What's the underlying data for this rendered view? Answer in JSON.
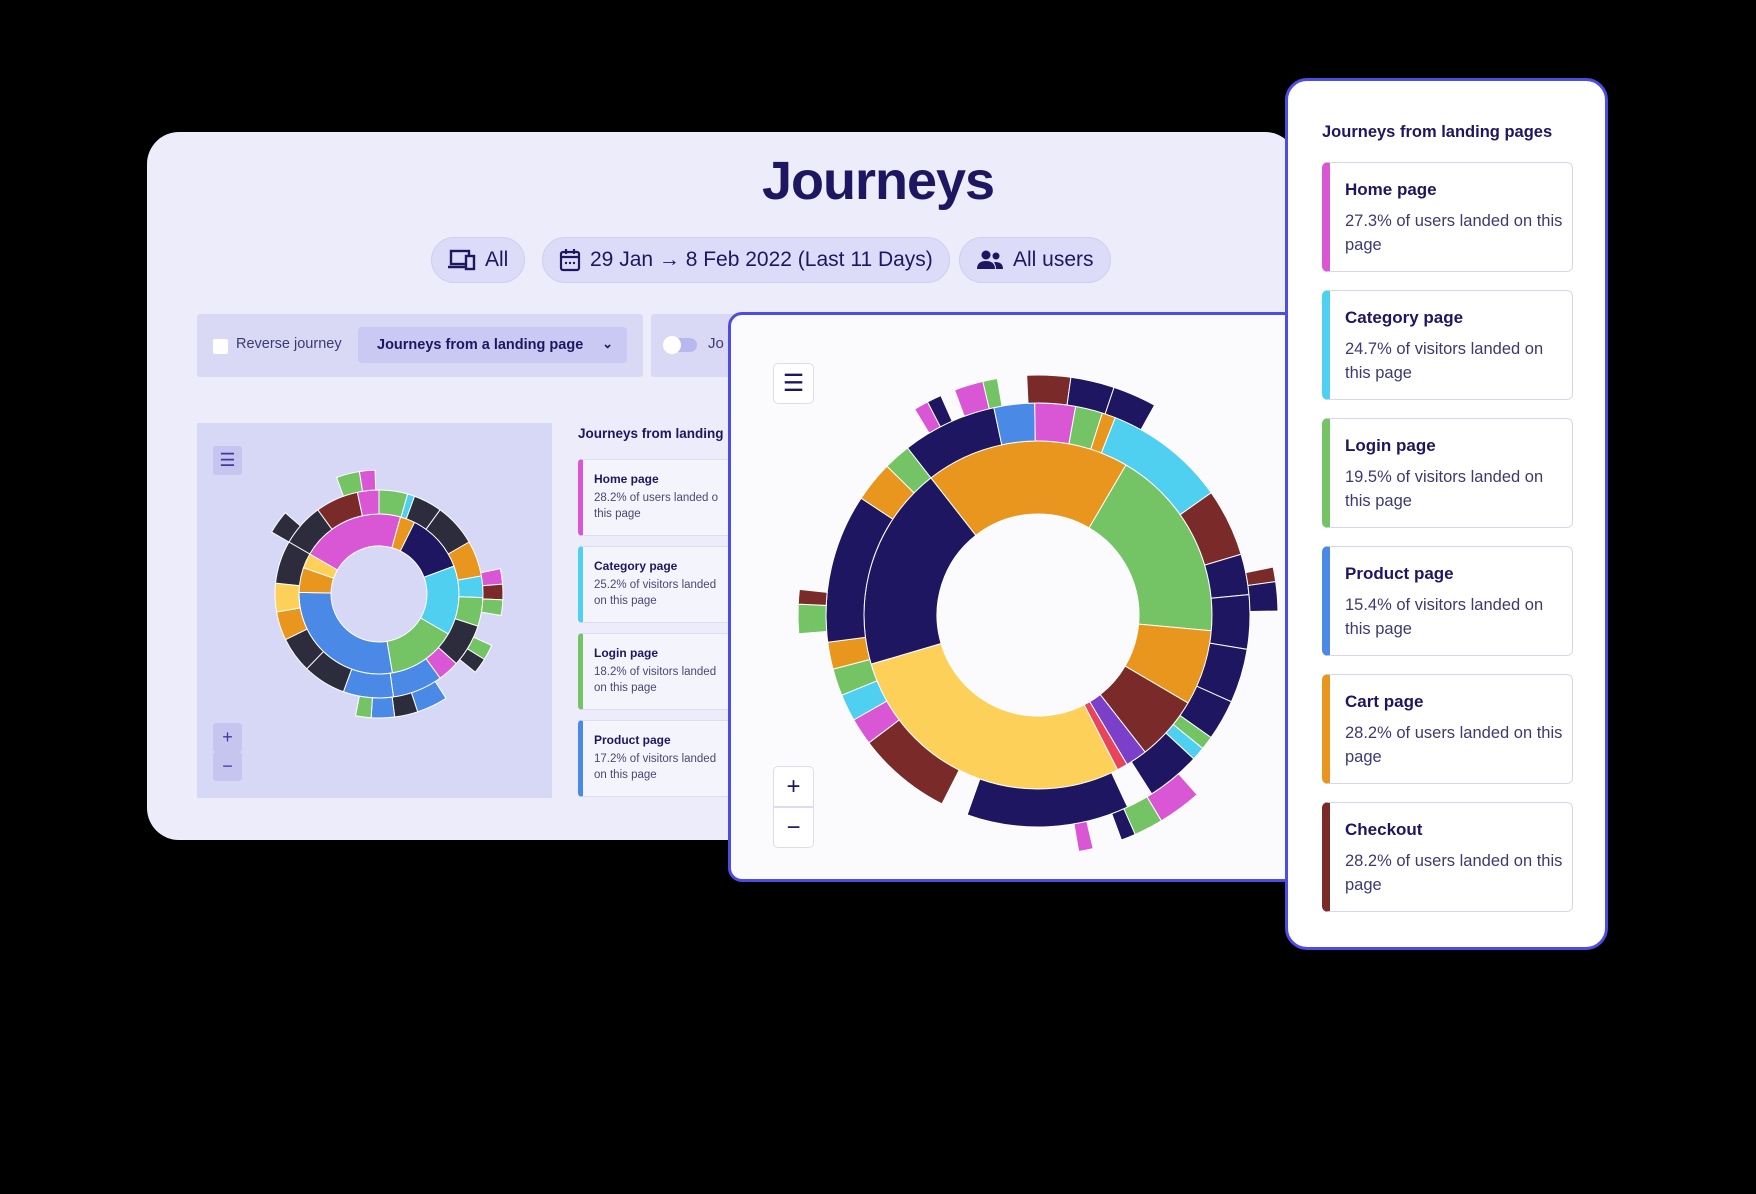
{
  "page": {
    "title": "Journeys"
  },
  "filters": {
    "device": {
      "label": "All",
      "icon": "devices-icon"
    },
    "date": {
      "label": "29 Jan → 8 Feb 2022 (Last 11 Days)",
      "icon": "calendar-icon"
    },
    "segment": {
      "label": "All users",
      "icon": "users-icon"
    }
  },
  "controls": {
    "reverse_label": "Reverse journey",
    "reverse_checked": false,
    "journey_type": "Journeys from a landing page",
    "toggle_label": "Jo",
    "toggle_on": false
  },
  "zoom": {
    "in": "+",
    "out": "−"
  },
  "colors": {
    "navy": "#1e1660",
    "orange": "#e8961e",
    "green": "#74c365",
    "cyan": "#4fd0f0",
    "yellow": "#fdd05a",
    "darkred": "#7b2a2a",
    "magenta": "#d957d4",
    "blue": "#4a8ae6",
    "purple": "#7b3fc9",
    "red": "#e8455a",
    "gray": "#2c2c3c",
    "accent": "#4d4ce6"
  },
  "background_list": {
    "title": "Journeys from landing",
    "items": [
      {
        "name": "Home page",
        "text": "28.2% of users landed o",
        "tail": "this page",
        "color": "#d957d4"
      },
      {
        "name": "Category page",
        "text": "25.2% of visitors landed",
        "tail": "on this page",
        "color": "#4fd0f0"
      },
      {
        "name": "Login page",
        "text": "18.2% of visitors landed",
        "tail": "on this page",
        "color": "#74c365"
      },
      {
        "name": "Product page",
        "text": "17.2% of visitors landed",
        "tail": "on this page",
        "color": "#4a8ae6"
      }
    ]
  },
  "landing_pages": {
    "title": "Journeys from landing pages",
    "items": [
      {
        "name": "Home page",
        "text": "27.3% of users landed on this page",
        "color": "#d957d4"
      },
      {
        "name": "Category page",
        "text": "24.7% of visitors landed on this page",
        "color": "#4fd0f0"
      },
      {
        "name": "Login page",
        "text": "19.5% of visitors landed on this page",
        "color": "#74c365"
      },
      {
        "name": "Product page",
        "text": "15.4% of visitors landed on this page",
        "color": "#4a8ae6"
      },
      {
        "name": "Cart page",
        "text": "28.2% of users landed on this page",
        "color": "#e8961e"
      },
      {
        "name": "Checkout",
        "text": "28.2% of users landed on this page",
        "color": "#7b2a2a"
      }
    ]
  },
  "sunburst_large": [
    [
      [
        "orange",
        19
      ],
      [
        "green",
        18
      ],
      [
        "orange",
        7
      ],
      [
        "darkred",
        6
      ],
      [
        "purple",
        2
      ],
      [
        "red",
        1
      ],
      [
        "yellow",
        28
      ],
      [
        "navy",
        19
      ]
    ],
    [
      [
        "navy",
        7
      ],
      [
        "blue",
        3
      ],
      [
        "magenta",
        3
      ],
      [
        "green",
        2
      ],
      [
        "orange",
        1
      ],
      [
        "cyan",
        9
      ],
      [
        "darkred",
        5
      ],
      [
        "navy",
        3
      ],
      [
        "navy",
        4
      ],
      [
        "navy",
        4
      ],
      [
        "navy",
        3
      ],
      [
        "green",
        1
      ],
      [
        "cyan",
        1
      ],
      [
        "navy",
        4
      ],
      [
        "null",
        2
      ],
      [
        "navy",
        12
      ],
      [
        "null",
        2
      ],
      [
        "darkred",
        7
      ],
      [
        "magenta",
        2
      ],
      [
        "cyan",
        2
      ],
      [
        "green",
        2
      ],
      [
        "orange",
        2
      ],
      [
        "navy",
        11
      ],
      [
        "orange",
        3
      ],
      [
        "green",
        2
      ]
    ],
    [
      [
        "null",
        2
      ],
      [
        "magenta",
        1
      ],
      [
        "navy",
        1
      ],
      [
        "null",
        1
      ],
      [
        "magenta",
        2
      ],
      [
        "green",
        1
      ],
      [
        "null",
        2
      ],
      [
        "darkred",
        3
      ],
      [
        "navy",
        3
      ],
      [
        "navy",
        3
      ],
      [
        "null",
        14
      ],
      [
        "darkred",
        1
      ],
      [
        "navy",
        2
      ],
      [
        "null",
        14
      ],
      [
        "magenta",
        3
      ],
      [
        "green",
        2
      ],
      [
        "navy",
        1
      ],
      [
        "null",
        2
      ],
      [
        "magenta",
        1
      ],
      [
        "null",
        27
      ],
      [
        "green",
        2
      ],
      [
        "darkred",
        1
      ],
      [
        "null",
        13
      ]
    ]
  ],
  "sunburst_small": [
    [
      [
        "magenta",
        21
      ],
      [
        "orange",
        3
      ],
      [
        "navy",
        12
      ],
      [
        "cyan",
        14
      ],
      [
        "green",
        14
      ],
      [
        "blue",
        28
      ],
      [
        "orange",
        5
      ],
      [
        "yellow",
        3
      ]
    ],
    [
      [
        "gray",
        6
      ],
      [
        "darkred",
        6
      ],
      [
        "magenta",
        3
      ],
      [
        "green",
        4
      ],
      [
        "cyan",
        1
      ],
      [
        "gray",
        4
      ],
      [
        "gray",
        6
      ],
      [
        "orange",
        5
      ],
      [
        "cyan",
        3
      ],
      [
        "green",
        4
      ],
      [
        "gray",
        6
      ],
      [
        "magenta",
        3
      ],
      [
        "blue",
        7
      ],
      [
        "blue",
        7
      ],
      [
        "gray",
        6
      ],
      [
        "gray",
        5
      ],
      [
        "orange",
        4
      ],
      [
        "yellow",
        4
      ],
      [
        "gray",
        6
      ]
    ],
    [
      [
        "gray",
        3
      ],
      [
        "null",
        8
      ],
      [
        "green",
        3
      ],
      [
        "magenta",
        2
      ],
      [
        "null",
        22
      ],
      [
        "magenta",
        2
      ],
      [
        "darkred",
        2
      ],
      [
        "green",
        2
      ],
      [
        "null",
        4
      ],
      [
        "green",
        2
      ],
      [
        "gray",
        2
      ],
      [
        "null",
        5
      ],
      [
        "blue",
        4
      ],
      [
        "gray",
        3
      ],
      [
        "blue",
        3
      ],
      [
        "green",
        2
      ],
      [
        "null",
        30
      ]
    ]
  ]
}
